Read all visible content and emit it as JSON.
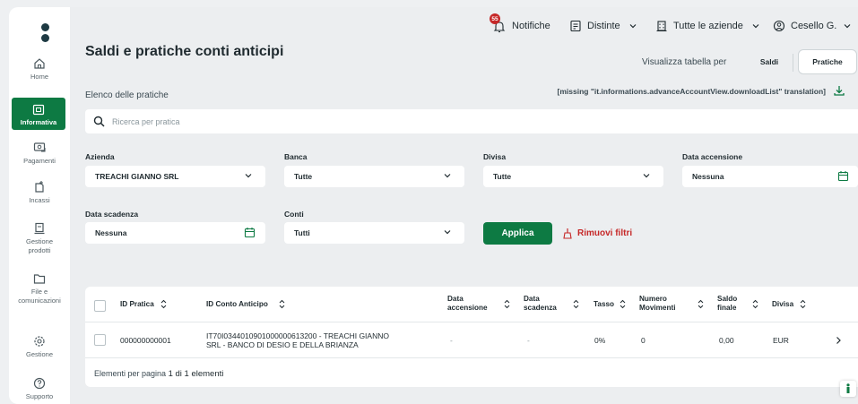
{
  "sidebar": {
    "items": [
      {
        "label": "Home",
        "icon": "home-icon"
      },
      {
        "label": "Informativa",
        "icon": "monitor-icon",
        "active": true
      },
      {
        "label": "Pagamenti",
        "icon": "payments-icon"
      },
      {
        "label": "Incassi",
        "icon": "collections-icon"
      },
      {
        "label": "Gestione prodotti",
        "icon": "products-icon"
      },
      {
        "label": "File e comunicazioni",
        "icon": "folder-icon"
      },
      {
        "label": "Gestione",
        "icon": "gear-icon"
      },
      {
        "label": "Supporto",
        "icon": "help-icon"
      }
    ]
  },
  "topbar": {
    "notifications_label": "Notifiche",
    "notifications_count": "55",
    "distinte_label": "Distinte",
    "aziende_label": "Tutte le aziende",
    "user_label": "Cesello G."
  },
  "page": {
    "title": "Saldi e pratiche conti anticipi",
    "view_label": "Visualizza tabella per",
    "view_options": [
      "Saldi",
      "Pratiche"
    ],
    "list_title": "Elenco delle pratiche",
    "missing_translation": "[missing \"it.informations.advanceAccountView.downloadList\" translation]"
  },
  "search": {
    "placeholder": "Ricerca per pratica"
  },
  "filters": {
    "azienda": {
      "label": "Azienda",
      "value": "TREACHI GIANNO SRL"
    },
    "banca": {
      "label": "Banca",
      "value": "Tutte"
    },
    "divisa": {
      "label": "Divisa",
      "value": "Tutte"
    },
    "data_accensione": {
      "label": "Data accensione",
      "value": "Nessuna"
    },
    "data_scadenza": {
      "label": "Data scadenza",
      "value": "Nessuna"
    },
    "conti": {
      "label": "Conti",
      "value": "Tutti"
    },
    "apply_label": "Applica",
    "remove_label": "Rimuovi filtri"
  },
  "table": {
    "columns": {
      "id_pratica": "ID Pratica",
      "id_conto": "ID Conto Anticipo",
      "data_accensione_1": "Data",
      "data_accensione_2": "accensione",
      "data_scadenza_1": "Data",
      "data_scadenza_2": "scadenza",
      "tasso": "Tasso",
      "movimenti_1": "Numero",
      "movimenti_2": "Movimenti",
      "saldo_1": "Saldo",
      "saldo_2": "finale",
      "divisa": "Divisa"
    },
    "rows": [
      {
        "id_pratica": "000000000001",
        "id_conto_1": "IT70I0344010901000000613200 - TREACHI GIANNO",
        "id_conto_2": "SRL - BANCO DI DESIO E DELLA BRIANZA",
        "data_accensione": "-",
        "data_scadenza": "-",
        "tasso": "0%",
        "movimenti": "0",
        "saldo": "0,00",
        "divisa": "EUR"
      }
    ],
    "footer_label": "Elementi per pagina",
    "footer_count": "1 di 1 elementi"
  },
  "colors": {
    "accent": "#0d7a43",
    "danger": "#c62828",
    "background": "#eceef0"
  }
}
